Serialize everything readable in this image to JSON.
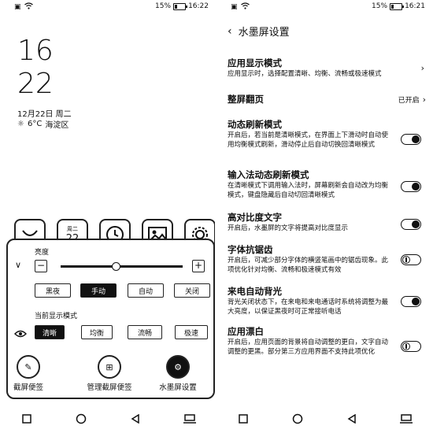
{
  "left": {
    "status": {
      "battery": "15%",
      "time": "16:22"
    },
    "clock": {
      "hour": "16",
      "minute": "22"
    },
    "date": "12月22日 周二",
    "weather": {
      "temp": "6°C",
      "location": "海淀区",
      "icon": "sun-icon"
    },
    "apps": [
      {
        "name": "app-1",
        "icon": "smile-icon"
      },
      {
        "name": "calendar",
        "text_top": "周二",
        "text_main": "22"
      },
      {
        "name": "clock-app",
        "icon": "clock-icon"
      },
      {
        "name": "gallery",
        "icon": "picture-icon"
      },
      {
        "name": "settings",
        "icon": "gear-icon"
      }
    ],
    "panel": {
      "brightness_label": "亮度",
      "brightness_level": 0.45,
      "modes": [
        "黑夜",
        "手动",
        "自动",
        "关闭"
      ],
      "active_mode": 1,
      "display_mode_label": "当前显示模式",
      "display_modes": [
        "清晰",
        "均衡",
        "流畅",
        "极速"
      ],
      "active_display_mode": 0,
      "tools": [
        {
          "label": "截屏便签",
          "icon": "screenshot-note-icon"
        },
        {
          "label": "管理截屏便签",
          "icon": "manage-notes-icon"
        },
        {
          "label": "水墨屏设置",
          "icon": "gear-icon"
        }
      ]
    }
  },
  "right": {
    "status": {
      "battery": "15%",
      "time": "16:21"
    },
    "title": "水墨屏设置",
    "settings": [
      {
        "title": "应用显示模式",
        "desc": "应用显示时，选择配置清晰、均衡、流畅或极速模式",
        "control": "chevron"
      },
      {
        "title": "整屏翻页",
        "value": "已开启",
        "control": "chevron-value"
      },
      {
        "title": "动态刷新模式",
        "desc": "开启后，若当前是清晰模式，在界面上下滑动时自动使用均衡模式刷新，滑动停止后自动切换回清晰模式",
        "control": "toggle",
        "on": true
      },
      {
        "title": "输入法动态刷新模式",
        "desc": "在清晰模式下调用输入法时，屏幕刷新会自动改为均衡模式，键盘隐藏后自动切回清晰模式",
        "control": "toggle",
        "on": true
      },
      {
        "title": "高对比度文字",
        "desc": "开启后，水墨屏的文字将提高对比度显示",
        "control": "toggle",
        "on": true
      },
      {
        "title": "字体抗锯齿",
        "desc": "开启后，可减少部分字体的横竖笔画中的锯齿现象。此项优化针对均衡、流畅和极速模式有效",
        "control": "toggle",
        "on": false
      },
      {
        "title": "来电自动背光",
        "desc": "背光关闭状态下，在来电和来电通话时系统将调整为最大亮度，以保证黑夜时可正常接听电话",
        "control": "toggle",
        "on": true
      },
      {
        "title": "应用漂白",
        "desc": "开启后，应用页面的背景将自动调整的更白，文字自动调整的更黑。部分第三方应用界面不支持此项优化",
        "control": "toggle",
        "on": false
      }
    ]
  }
}
